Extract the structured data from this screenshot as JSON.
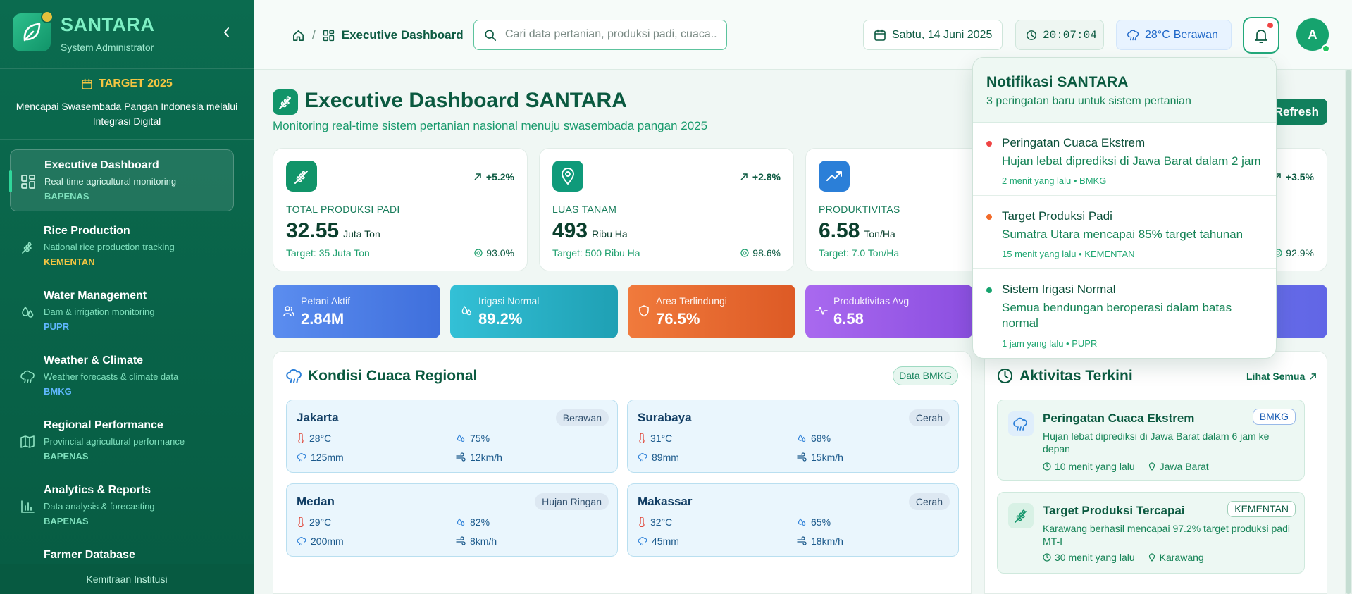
{
  "app": {
    "name": "SANTARA",
    "role": "System Administrator"
  },
  "target": {
    "title": "TARGET 2025",
    "description": "Mencapai Swasembada Pangan Indonesia melalui Integrasi Digital"
  },
  "sidebar": {
    "items": [
      {
        "title": "Executive Dashboard",
        "desc": "Real-time agricultural monitoring",
        "agency": "BAPENAS",
        "agency_color": "#7fe0bd",
        "icon": "dashboard-grid-icon"
      },
      {
        "title": "Rice Production",
        "desc": "National rice production tracking",
        "agency": "KEMENTAN",
        "agency_color": "#f4c542",
        "icon": "wheat-icon"
      },
      {
        "title": "Water Management",
        "desc": "Dam & irrigation monitoring",
        "agency": "PUPR",
        "agency_color": "#60b8ff",
        "icon": "droplets-icon"
      },
      {
        "title": "Weather & Climate",
        "desc": "Weather forecasts & climate data",
        "agency": "BMKG",
        "agency_color": "#60b8ff",
        "icon": "cloud-rain-icon"
      },
      {
        "title": "Regional Performance",
        "desc": "Provincial agricultural performance",
        "agency": "BAPENAS",
        "agency_color": "#7fe0bd",
        "icon": "map-icon"
      },
      {
        "title": "Analytics & Reports",
        "desc": "Data analysis & forecasting",
        "agency": "BAPENAS",
        "agency_color": "#7fe0bd",
        "icon": "bar-chart-icon"
      },
      {
        "title": "Farmer Database",
        "desc": "",
        "agency": "",
        "agency_color": "#7fe0bd",
        "icon": "users-icon"
      }
    ],
    "footer": "Kemitraan Institusi"
  },
  "header": {
    "breadcrumb": "Executive Dashboard",
    "search_placeholder": "Cari data pertanian, produksi padi, cuaca...",
    "date": "Sabtu, 14 Juni 2025",
    "time": "20:07:04",
    "temp": "28°C",
    "weather": "Berawan",
    "avatar": "A"
  },
  "page": {
    "title": "Executive Dashboard SANTARA",
    "subtitle": "Monitoring real-time sistem pertanian nasional menuju swasembada pangan 2025",
    "refresh_label": "Refresh"
  },
  "kpis": [
    {
      "label": "TOTAL PRODUKSI PADI",
      "value": "32.55",
      "unit": "Juta Ton",
      "trend": "+5.2%",
      "target": "Target: 35 Juta Ton",
      "percent": "93.0%",
      "color": "#119469"
    },
    {
      "label": "LUAS TANAM",
      "value": "493",
      "unit": "Ribu Ha",
      "trend": "+2.8%",
      "target": "Target: 500 Ribu Ha",
      "percent": "98.6%",
      "color": "#0f9a7a"
    },
    {
      "label": "PRODUKTIVITAS",
      "value": "6.58",
      "unit": "Ton/Ha",
      "trend": "",
      "target": "Target: 7.0 Ton/Ha",
      "percent": "",
      "color": "#2b7fd8"
    },
    {
      "label": "",
      "value": "",
      "unit": "",
      "trend": "+3.5%",
      "target": "",
      "percent": "92.9%",
      "color": "#119469"
    }
  ],
  "mini_stats": [
    {
      "label": "Petani Aktif",
      "value": "2.84M",
      "color_a": "#5b8def",
      "color_b": "#3f6fdc"
    },
    {
      "label": "Irigasi Normal",
      "value": "89.2%",
      "color_a": "#33c0d6",
      "color_b": "#1fa0b4"
    },
    {
      "label": "Area Terlindungi",
      "value": "76.5%",
      "color_a": "#f07a3c",
      "color_b": "#dd5a25"
    },
    {
      "label": "Produktivitas Avg",
      "value": "6.58",
      "color_a": "#a969ef",
      "color_b": "#8b4ee0"
    },
    {
      "label": "",
      "value": "",
      "color_a": "#7b7ff0",
      "color_b": "#6166e6"
    }
  ],
  "weather": {
    "title": "Kondisi Cuaca Regional",
    "source": "Data BMKG",
    "cities": [
      {
        "name": "Jakarta",
        "condition": "Berawan",
        "temp": "28°C",
        "humidity": "75%",
        "rain": "125mm",
        "wind": "12km/h"
      },
      {
        "name": "Surabaya",
        "condition": "Cerah",
        "temp": "31°C",
        "humidity": "68%",
        "rain": "89mm",
        "wind": "15km/h"
      },
      {
        "name": "Medan",
        "condition": "Hujan Ringan",
        "temp": "29°C",
        "humidity": "82%",
        "rain": "200mm",
        "wind": "8km/h"
      },
      {
        "name": "Makassar",
        "condition": "Cerah",
        "temp": "32°C",
        "humidity": "65%",
        "rain": "45mm",
        "wind": "18km/h"
      }
    ]
  },
  "activity": {
    "title": "Aktivitas Terkini",
    "see_all": "Lihat Semua",
    "items": [
      {
        "title": "Peringatan Cuaca Ekstrem",
        "tag": "BMKG",
        "desc": "Hujan lebat diprediksi di Jawa Barat dalam 6 jam ke depan",
        "time": "10 menit yang lalu",
        "location": "Jawa Barat"
      },
      {
        "title": "Target Produksi Tercapai",
        "tag": "KEMENTAN",
        "desc": "Karawang berhasil mencapai 97.2% target produksi padi MT-I",
        "time": "30 menit yang lalu",
        "location": "Karawang"
      }
    ]
  },
  "notifications": {
    "title": "Notifikasi SANTARA",
    "subtitle": "3 peringatan baru untuk sistem pertanian",
    "items": [
      {
        "title": "Peringatan Cuaca Ekstrem",
        "body": "Hujan lebat diprediksi di Jawa Barat dalam 2 jam",
        "meta": "2 menit yang lalu • BMKG",
        "color": "#ef4444"
      },
      {
        "title": "Target Produksi Padi",
        "body": "Sumatra Utara mencapai 85% target tahunan",
        "meta": "15 menit yang lalu • KEMENTAN",
        "color": "#f26b2a"
      },
      {
        "title": "Sistem Irigasi Normal",
        "body": "Semua bendungan beroperasi dalam batas normal",
        "meta": "1 jam yang lalu • PUPR",
        "color": "#16a36e"
      }
    ]
  }
}
